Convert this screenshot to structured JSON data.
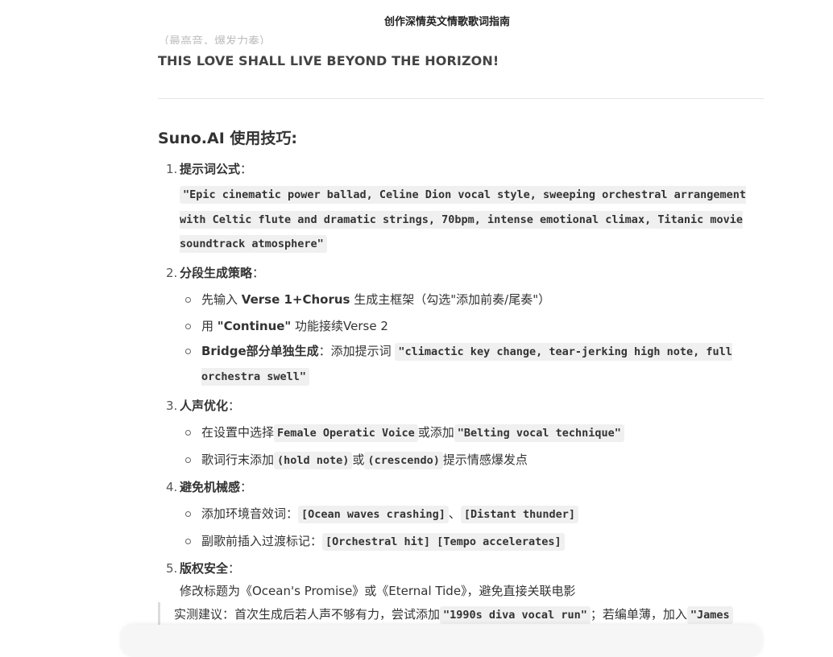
{
  "header": {
    "title": "创作深情英文情歌歌词指南"
  },
  "previous": {
    "cut_line": "（最高音，爆发力奏）",
    "banner": "THIS LOVE SHALL LIVE BEYOND THE HORIZON!"
  },
  "section": {
    "title": "Suno.AI 使用技巧:",
    "items": [
      {
        "num": "1.",
        "head": "提示词公式",
        "code": "\"Epic cinematic power ballad, Celine Dion vocal style, sweeping orchestral arrangement with Celtic flute and dramatic strings, 70bpm, intense emotional climax, Titanic movie soundtrack atmosphere\""
      },
      {
        "num": "2.",
        "head": "分段生成策略",
        "subs": [
          {
            "pre": "先输入 ",
            "bold": "Verse 1+Chorus",
            "post": " 生成主框架（勾选\"添加前奏/尾奏\"）"
          },
          {
            "pre": "用 ",
            "bold": "\"Continue\"",
            "post": " 功能接续Verse 2"
          },
          {
            "bold": "Bridge部分单独生成",
            "mid": "：添加提示词 ",
            "code": "\"climactic key change, tear-jerking high note, full orchestra swell\""
          }
        ]
      },
      {
        "num": "3.",
        "head": "人声优化",
        "subs": [
          {
            "pre": "在设置中选择",
            "code1": "Female Operatic Voice",
            "mid": "或添加",
            "code2": "\"Belting vocal technique\""
          },
          {
            "pre": "歌词行末添加",
            "code1": "(hold note)",
            "mid": "或",
            "code2": "(crescendo)",
            "post": "提示情感爆发点"
          }
        ]
      },
      {
        "num": "4.",
        "head": "避免机械感",
        "subs": [
          {
            "pre": "添加环境音效词：",
            "code1": "[Ocean waves crashing]",
            "mid": "、",
            "code2": "[Distant thunder]"
          },
          {
            "pre": "副歌前插入过渡标记：",
            "code1": "[Orchestral hit] [Tempo accelerates]"
          }
        ]
      },
      {
        "num": "5.",
        "head": "版权安全",
        "text": "修改标题为《Ocean's Promise》或《Eternal Tide》，避免直接关联电影"
      }
    ],
    "colon": "："
  },
  "note": {
    "pre": "实测建议：首次生成后若人声不够有力，尝试添加",
    "code1": "\"1990s diva vocal run\"",
    "mid": "；若编单薄，加入",
    "code2": "\"James"
  }
}
